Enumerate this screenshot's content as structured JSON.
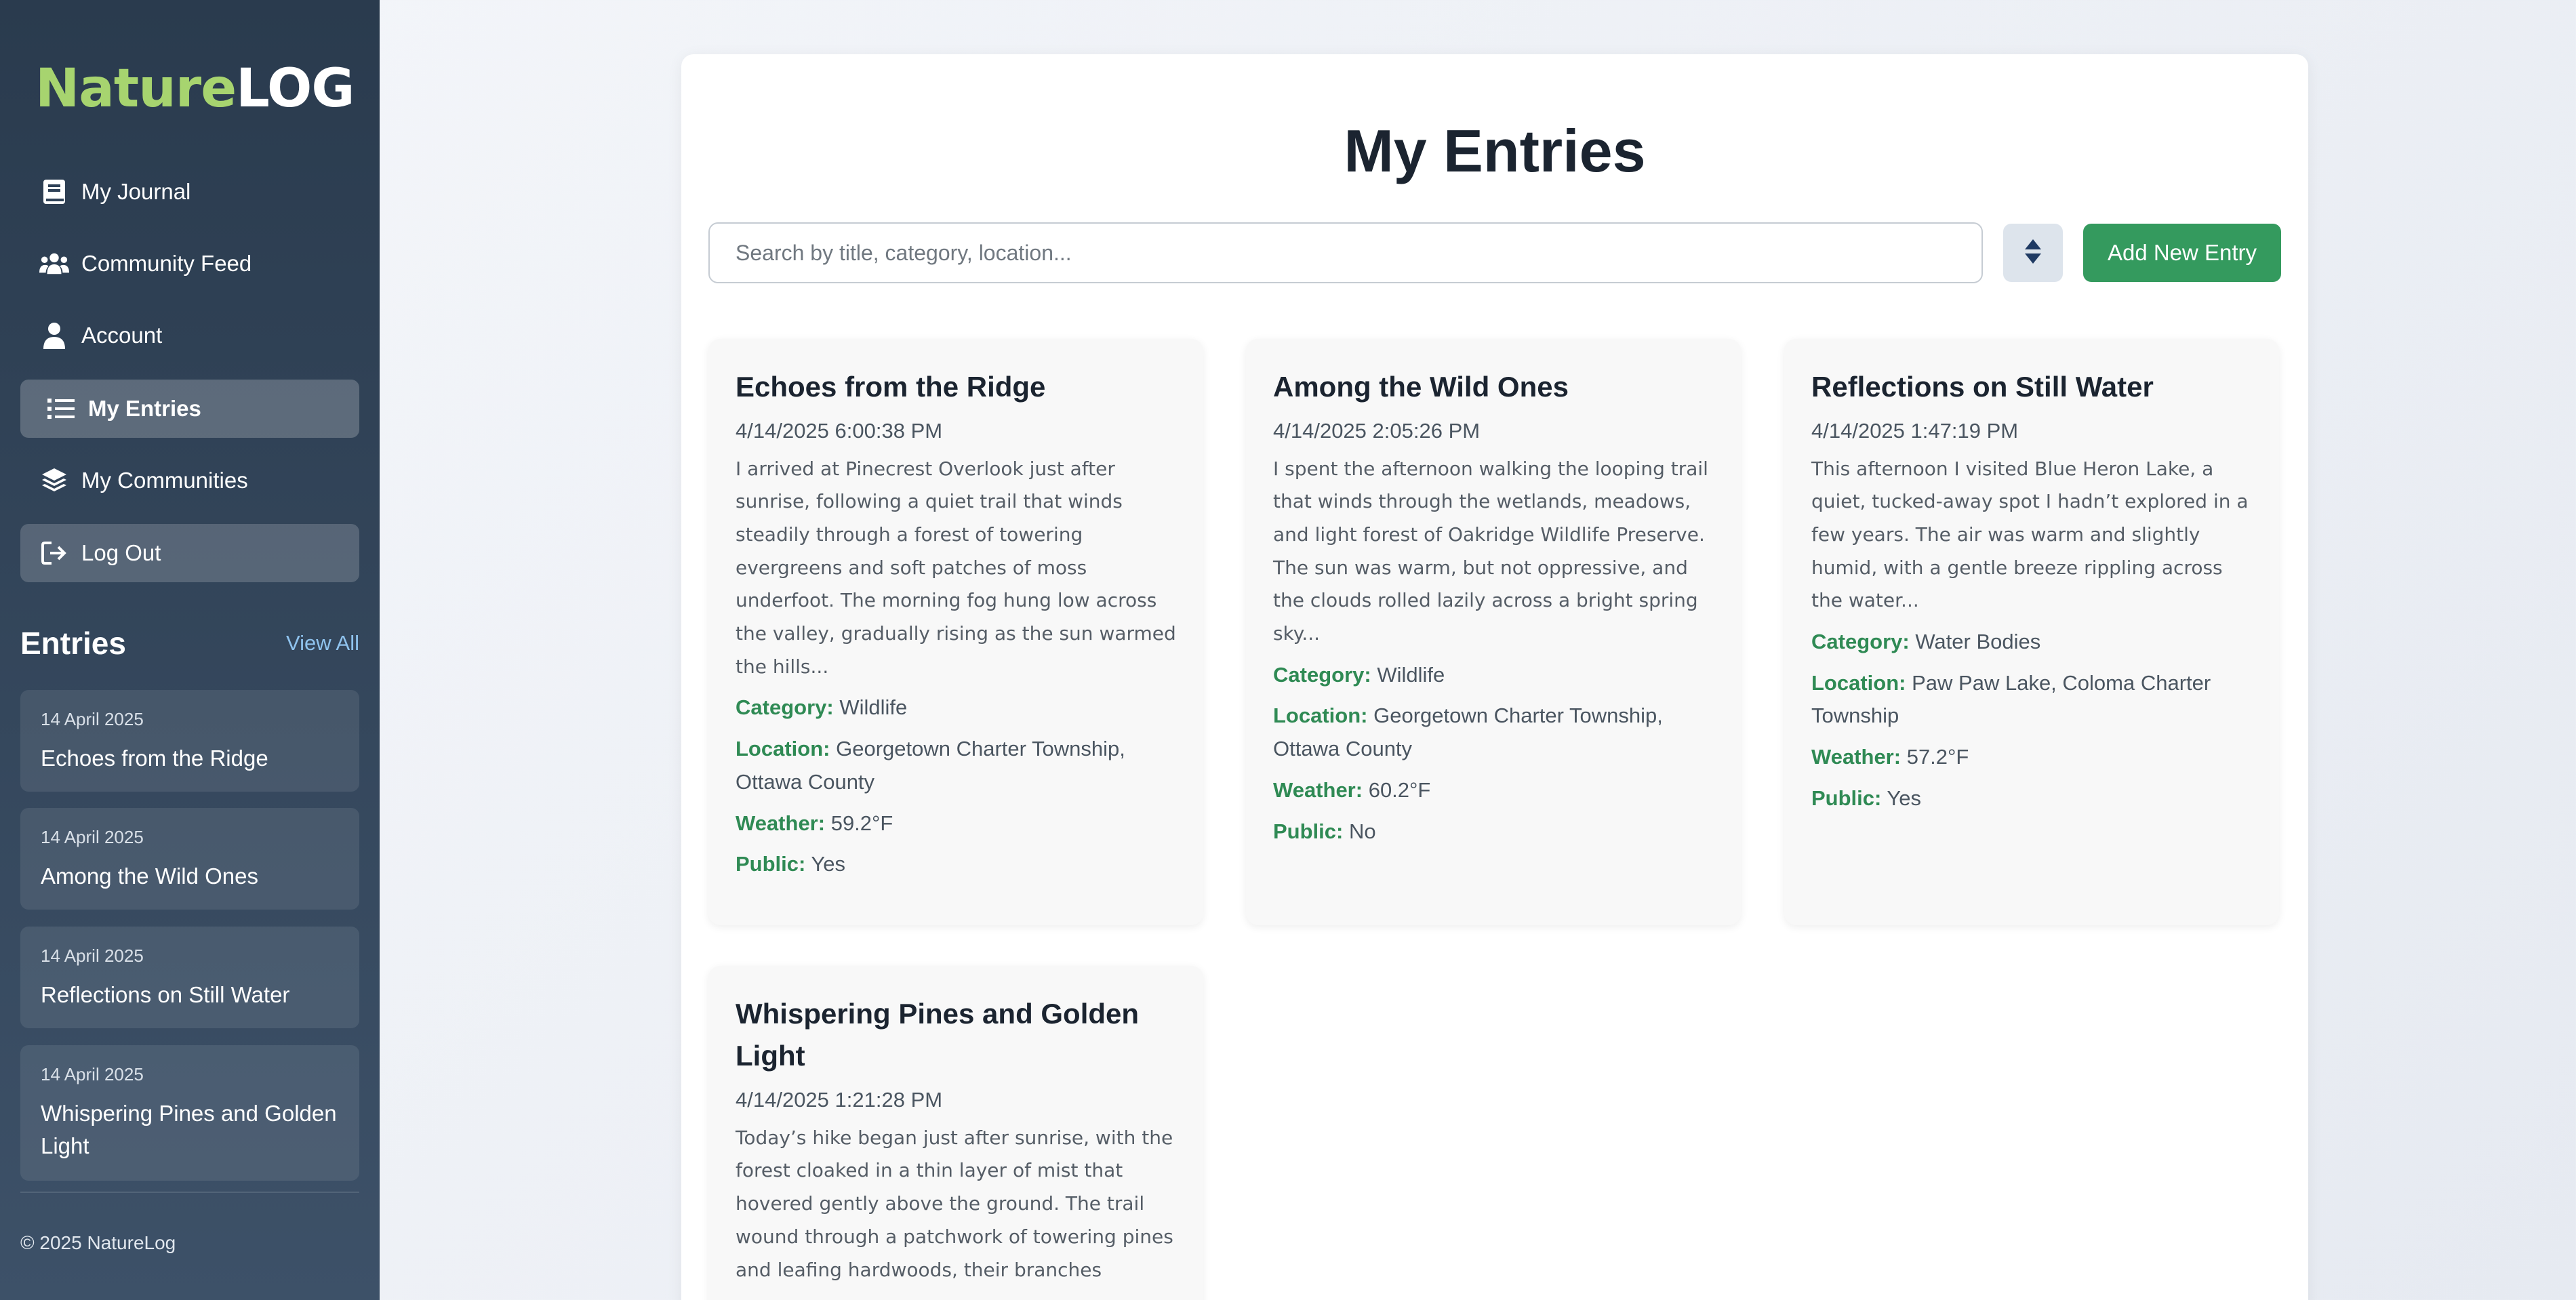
{
  "brand": {
    "part1": "Nature",
    "part2": "LOG"
  },
  "nav": [
    {
      "label": "My Journal",
      "icon": "book-icon"
    },
    {
      "label": "Community Feed",
      "icon": "users-icon"
    },
    {
      "label": "Account",
      "icon": "user-icon"
    },
    {
      "label": "My Entries",
      "icon": "list-icon",
      "active": true
    },
    {
      "label": "My Communities",
      "icon": "layers-icon"
    },
    {
      "label": "Log Out",
      "icon": "logout-icon"
    }
  ],
  "sidebar_entries": {
    "title": "Entries",
    "view_all": "View All",
    "items": [
      {
        "date": "14 April 2025",
        "title": "Echoes from the Ridge"
      },
      {
        "date": "14 April 2025",
        "title": "Among the Wild Ones"
      },
      {
        "date": "14 April 2025",
        "title": "Reflections on Still Water"
      },
      {
        "date": "14 April 2025",
        "title": "Whispering Pines and Golden Light"
      }
    ]
  },
  "footer": {
    "copyright": "© 2025 NatureLog"
  },
  "main": {
    "title": "My Entries",
    "search_placeholder": "Search by title, category, location...",
    "add_label": "Add New Entry",
    "labels": {
      "category": "Category:",
      "location": "Location:",
      "weather": "Weather:",
      "public": "Public:"
    },
    "entries": [
      {
        "title": "Echoes from the Ridge",
        "datetime": "4/14/2025 6:00:38 PM",
        "excerpt": "I arrived at Pinecrest Overlook just after sunrise, following a quiet trail that winds steadily through a forest of towering evergreens and soft patches of moss underfoot. The morning fog hung low across the valley, gradually rising as the sun warmed the hills...",
        "category": "Wildlife",
        "location": "Georgetown Charter Township, Ottawa County",
        "weather": "59.2°F",
        "public": "Yes"
      },
      {
        "title": "Among the Wild Ones",
        "datetime": "4/14/2025 2:05:26 PM",
        "excerpt": "I spent the afternoon walking the looping trail that winds through the wetlands, meadows, and light forest of Oakridge Wildlife Preserve. The sun was warm, but not oppressive, and the clouds rolled lazily across a bright spring sky...",
        "category": "Wildlife",
        "location": "Georgetown Charter Township, Ottawa County",
        "weather": "60.2°F",
        "public": "No"
      },
      {
        "title": "Reflections on Still Water",
        "datetime": "4/14/2025 1:47:19 PM",
        "excerpt": "This afternoon I visited Blue Heron Lake, a quiet, tucked-away spot I hadn’t explored in a few years. The air was warm and slightly humid, with a gentle breeze rippling across the water...",
        "category": "Water Bodies",
        "location": "Paw Paw Lake, Coloma Charter Township",
        "weather": "57.2°F",
        "public": "Yes"
      },
      {
        "title": "Whispering Pines and Golden Light",
        "datetime": "4/14/2025 1:21:28 PM",
        "excerpt": "Today’s hike began just after sunrise, with the forest cloaked in a thin layer of mist that hovered gently above the ground. The trail wound through a patchwork of towering pines and leafing hardwoods, their branches"
      }
    ]
  },
  "colors": {
    "accent": "#349a5e",
    "label_green": "#2f8a54",
    "logo_green": "#a7d46f",
    "sidebar": "#2f4258"
  }
}
